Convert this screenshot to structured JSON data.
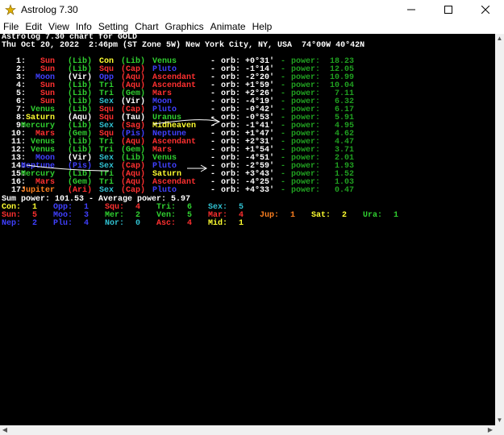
{
  "window": {
    "title": "Astrolog 7.30"
  },
  "menu": [
    "File",
    "Edit",
    "View",
    "Info",
    "Setting",
    "Chart",
    "Graphics",
    "Animate",
    "Help"
  ],
  "header": {
    "line1": "Astrolog 7.30 chart for GOLD",
    "line2": "Thu Oct 20, 2022  2:46pm (ST Zone 5W) New York City, NY, USA  74°00W 40°42N"
  },
  "colors": {
    "white": "#ffffff",
    "red": "#ff3030",
    "green": "#30d030",
    "blue": "#4040ff",
    "yellow": "#ffff30",
    "dgreen": "#20a020",
    "cyan": "#30c0d0",
    "orange": "#ff8020",
    "magenta": "#e03060"
  },
  "aspects": [
    {
      "num": "1:",
      "p1": "Sun",
      "p1c": "red",
      "s1": "(Lib)",
      "s1c": "green",
      "asp": "Con",
      "aspc": "yellow",
      "s2": "(Lib)",
      "s2c": "green",
      "p2": "Venus",
      "p2c": "green",
      "orb": "+0°31'",
      "power": "18.23"
    },
    {
      "num": "2:",
      "p1": "Sun",
      "p1c": "red",
      "s1": "(Lib)",
      "s1c": "green",
      "asp": "Squ",
      "aspc": "red",
      "s2": "(Cap)",
      "s2c": "red",
      "p2": "Pluto",
      "p2c": "blue",
      "orb": "-1°14'",
      "power": "12.05"
    },
    {
      "num": "3:",
      "p1": "Moon",
      "p1c": "blue",
      "s1": "(Vir)",
      "s1c": "white",
      "asp": "Opp",
      "aspc": "blue",
      "s2": "(Aqu)",
      "s2c": "red",
      "p2": "Ascendant",
      "p2c": "red",
      "orb": "-2°20'",
      "power": "10.99"
    },
    {
      "num": "4:",
      "p1": "Sun",
      "p1c": "red",
      "s1": "(Lib)",
      "s1c": "green",
      "asp": "Tri",
      "aspc": "green",
      "s2": "(Aqu)",
      "s2c": "red",
      "p2": "Ascendant",
      "p2c": "red",
      "orb": "+1°59'",
      "power": "10.04"
    },
    {
      "num": "5:",
      "p1": "Sun",
      "p1c": "red",
      "s1": "(Lib)",
      "s1c": "green",
      "asp": "Tri",
      "aspc": "green",
      "s2": "(Gem)",
      "s2c": "green",
      "p2": "Mars",
      "p2c": "red",
      "orb": "+2°26'",
      "power": "7.11"
    },
    {
      "num": "6:",
      "p1": "Sun",
      "p1c": "red",
      "s1": "(Lib)",
      "s1c": "green",
      "asp": "Sex",
      "aspc": "cyan",
      "s2": "(Vir)",
      "s2c": "white",
      "p2": "Moon",
      "p2c": "blue",
      "orb": "-4°19'",
      "power": "6.32"
    },
    {
      "num": "7:",
      "p1": "Venus",
      "p1c": "green",
      "s1": "(Lib)",
      "s1c": "green",
      "asp": "Squ",
      "aspc": "red",
      "s2": "(Cap)",
      "s2c": "red",
      "p2": "Pluto",
      "p2c": "blue",
      "orb": "-0°42'",
      "power": "6.17"
    },
    {
      "num": "8:",
      "p1": "Saturn",
      "p1c": "yellow",
      "s1": "(Aqu)",
      "s1c": "white",
      "asp": "Squ",
      "aspc": "red",
      "s2": "(Tau)",
      "s2c": "white",
      "p2": "Uranus",
      "p2c": "green",
      "orb": "-0°53'",
      "power": "5.91"
    },
    {
      "num": "9:",
      "p1": "Mercury",
      "p1c": "green",
      "s1": "(Lib)",
      "s1c": "green",
      "asp": "Sex",
      "aspc": "cyan",
      "s2": "(Sag)",
      "s2c": "red",
      "p2": "Midheaven",
      "p2c": "yellow",
      "orb": "-1°41'",
      "power": "4.95"
    },
    {
      "num": "10:",
      "p1": "Mars",
      "p1c": "red",
      "s1": "(Gem)",
      "s1c": "green",
      "asp": "Squ",
      "aspc": "red",
      "s2": "(Pis)",
      "s2c": "blue",
      "p2": "Neptune",
      "p2c": "blue",
      "orb": "+1°47'",
      "power": "4.62"
    },
    {
      "num": "11:",
      "p1": "Venus",
      "p1c": "green",
      "s1": "(Lib)",
      "s1c": "green",
      "asp": "Tri",
      "aspc": "green",
      "s2": "(Aqu)",
      "s2c": "red",
      "p2": "Ascendant",
      "p2c": "red",
      "orb": "+2°31'",
      "power": "4.47"
    },
    {
      "num": "12:",
      "p1": "Venus",
      "p1c": "green",
      "s1": "(Lib)",
      "s1c": "green",
      "asp": "Tri",
      "aspc": "green",
      "s2": "(Gem)",
      "s2c": "green",
      "p2": "Mars",
      "p2c": "red",
      "orb": "+1°54'",
      "power": "3.71"
    },
    {
      "num": "13:",
      "p1": "Moon",
      "p1c": "blue",
      "s1": "(Vir)",
      "s1c": "white",
      "asp": "Sex",
      "aspc": "cyan",
      "s2": "(Lib)",
      "s2c": "green",
      "p2": "Venus",
      "p2c": "green",
      "orb": "-4°51'",
      "power": "2.01"
    },
    {
      "num": "14:",
      "p1": "Neptune",
      "p1c": "blue",
      "s1": "(Pis)",
      "s1c": "blue",
      "asp": "Sex",
      "aspc": "cyan",
      "s2": "(Cap)",
      "s2c": "red",
      "p2": "Pluto",
      "p2c": "blue",
      "orb": "-2°59'",
      "power": "1.93"
    },
    {
      "num": "15:",
      "p1": "Mercury",
      "p1c": "green",
      "s1": "(Lib)",
      "s1c": "green",
      "asp": "Tri",
      "aspc": "green",
      "s2": "(Aqu)",
      "s2c": "red",
      "p2": "Saturn",
      "p2c": "yellow",
      "orb": "+3°43'",
      "power": "1.52"
    },
    {
      "num": "16:",
      "p1": "Mars",
      "p1c": "red",
      "s1": "(Gem)",
      "s1c": "green",
      "asp": "Tri",
      "aspc": "green",
      "s2": "(Aqu)",
      "s2c": "red",
      "p2": "Ascendant",
      "p2c": "red",
      "orb": "-4°25'",
      "power": "1.03"
    },
    {
      "num": "17:",
      "p1": "Jupiter",
      "p1c": "orange",
      "s1": "(Ari)",
      "s1c": "red",
      "asp": "Sex",
      "aspc": "cyan",
      "s2": "(Cap)",
      "s2c": "red",
      "p2": "Pluto",
      "p2c": "blue",
      "orb": "+4°33'",
      "power": "0.47"
    }
  ],
  "labels": {
    "orb": "orb:",
    "power": "power:",
    "dash": "-"
  },
  "summary": "Sum power: 101.53 - Average power: 5.97",
  "counts": [
    [
      {
        "label": "Con:",
        "value": "1",
        "color": "yellow"
      },
      {
        "label": "Opp:",
        "value": "1",
        "color": "blue"
      },
      {
        "label": "Squ:",
        "value": "4",
        "color": "red"
      },
      {
        "label": "Tri:",
        "value": "6",
        "color": "green"
      },
      {
        "label": "Sex:",
        "value": "5",
        "color": "cyan"
      }
    ],
    [
      {
        "label": "Sun:",
        "value": "5",
        "color": "red"
      },
      {
        "label": "Moo:",
        "value": "3",
        "color": "blue"
      },
      {
        "label": "Mer:",
        "value": "2",
        "color": "green"
      },
      {
        "label": "Ven:",
        "value": "5",
        "color": "green"
      },
      {
        "label": "Mar:",
        "value": "4",
        "color": "red"
      },
      {
        "label": "Jup:",
        "value": "1",
        "color": "orange"
      },
      {
        "label": "Sat:",
        "value": "2",
        "color": "yellow"
      },
      {
        "label": "Ura:",
        "value": "1",
        "color": "green"
      }
    ],
    [
      {
        "label": "Nep:",
        "value": "2",
        "color": "blue"
      },
      {
        "label": "Plu:",
        "value": "4",
        "color": "blue"
      },
      {
        "label": "Nor:",
        "value": "0",
        "color": "cyan"
      },
      {
        "label": "Asc:",
        "value": "4",
        "color": "red"
      },
      {
        "label": "Mid:",
        "value": "1",
        "color": "yellow"
      }
    ]
  ]
}
